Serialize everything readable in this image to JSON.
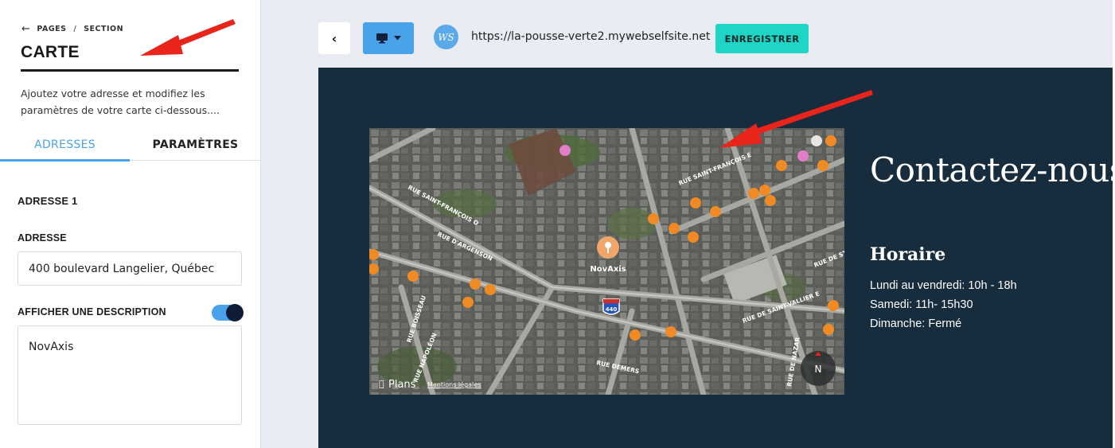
{
  "panel": {
    "breadcrumb": {
      "pages": "PAGES",
      "section": "SECTION"
    },
    "title": "CARTE",
    "intro": "Ajoutez votre adresse et modifiez les paramètres de votre carte ci-dessous....",
    "tabs": [
      {
        "label": "ADRESSES",
        "active": true
      },
      {
        "label": "PARAMÈTRES",
        "active": false
      }
    ],
    "address_block_title": "ADRESSE 1",
    "address_label": "ADRESSE",
    "address_value": "400 boulevard Langelier, Québec",
    "description_toggle_label": "AFFICHER UNE DESCRIPTION",
    "description_toggle_on": true,
    "description_value": "NovAxis"
  },
  "toolbar": {
    "back_icon": "chevron-left-icon",
    "device_icon": "desktop-icon",
    "logo_text": "WS",
    "url": "https://la-pousse-verte2.mywebselfsite.net",
    "save_label": "ENREGISTRER"
  },
  "map": {
    "marker_label": "NovAxis",
    "street_labels": [
      "RUE SAINT-FRANÇOIS E",
      "RUE SAINT-FRANÇOIS O",
      "RUE D'ARGENSON",
      "RUE DE STE-HÉ",
      "RUE DE SAINT-VALLIER E",
      "RUE BOISSEAU",
      "RUE NAPOLÉON",
      "RUE DEMERS",
      "RUE DE NAZAR"
    ],
    "highway_shield": "440",
    "brand": "Plans",
    "legal_link": "Mentions légales",
    "compass": "N"
  },
  "preview": {
    "contact_title": "Contactez-nous",
    "hours_title": "Horaire",
    "hours": [
      "Lundi au vendredi: 10h - 18h",
      "Samedi: 11h- 15h30",
      "Dimanche: Fermé"
    ]
  },
  "colors": {
    "accent_blue": "#4aa3ea",
    "save_teal": "#1fd6c6",
    "preview_bg": "#172c3d",
    "annotation_red": "#e8241b",
    "poi_orange": "#f08a24",
    "poi_pink": "#e07fc8"
  }
}
